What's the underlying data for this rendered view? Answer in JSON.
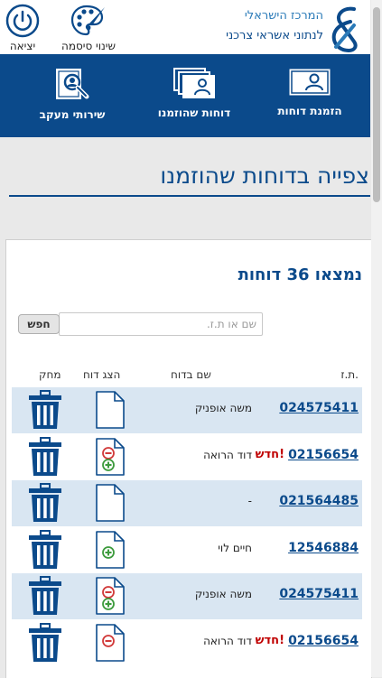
{
  "header": {
    "logo_line1": "המרכז הישראלי",
    "logo_line2": "לנתוני אשראי צרכני",
    "logo_icon": "center-logo-icon",
    "exit_label": "יציאה",
    "exit_icon": "power-icon",
    "change_password_label": "שינוי סיסמה",
    "change_password_icon": "palette-brush-icon"
  },
  "nav": {
    "items": [
      {
        "label": "הזמנת דוחות",
        "icon": "id-card-icon"
      },
      {
        "label": "דוחות שהוזמנו",
        "icon": "documents-stack-icon"
      },
      {
        "label": "שירותי מעקב",
        "icon": "search-person-icon"
      }
    ]
  },
  "page": {
    "title": "צפייה בדוחות שהוזמנו"
  },
  "results": {
    "found_text": "נמצאו 36 דוחות",
    "search_placeholder": "שם או ת.ז.",
    "search_button": "חפש"
  },
  "table": {
    "headers": {
      "id": "ת.ז.",
      "name": "שם בדוח",
      "show": "הצג דוח",
      "delete": "מחק"
    },
    "rows": [
      {
        "id": "024575411",
        "is_new": false,
        "new_label": "",
        "name": "משה אופניק",
        "doc": "blank"
      },
      {
        "id": "02156654",
        "is_new": true,
        "new_label": "חדש!",
        "name": "דוד הרואה",
        "doc": "minus-plus"
      },
      {
        "id": "021564485",
        "is_new": false,
        "new_label": "",
        "name": "-",
        "doc": "blank"
      },
      {
        "id": "12546884",
        "is_new": false,
        "new_label": "",
        "name": "חיים לוי",
        "doc": "plus"
      },
      {
        "id": "024575411",
        "is_new": false,
        "new_label": "",
        "name": "משה אופניק",
        "doc": "minus-plus"
      },
      {
        "id": "02156654",
        "is_new": true,
        "new_label": "חדש!",
        "name": "דוד הרואה",
        "doc": "minus"
      }
    ]
  },
  "colors": {
    "primary": "#0b4a8b",
    "accent": "#2a7ab8",
    "row_shade": "#d9e6f2",
    "new_badge": "#c00000",
    "minus_red": "#d13a3a",
    "plus_green": "#3d9b3d"
  }
}
